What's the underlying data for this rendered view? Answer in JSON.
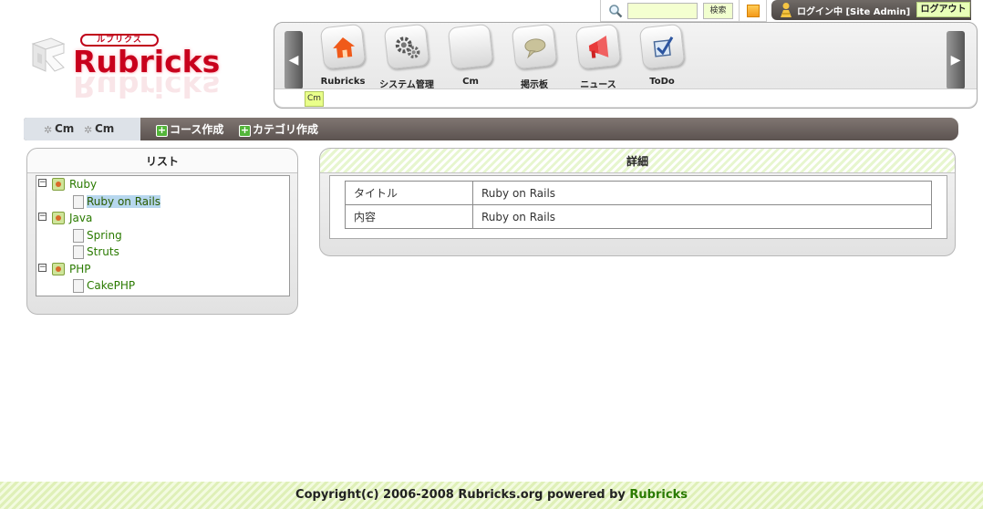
{
  "topbar": {
    "search_placeholder": "",
    "search_button": "検索",
    "user_label": "ログイン中 [Site Admin]",
    "logout_button": "ログアウト"
  },
  "logo": {
    "kana": "ルブリクス",
    "text": "Rubricks"
  },
  "menu": {
    "items": [
      {
        "label": "Rubricks",
        "icon": "house-icon"
      },
      {
        "label": "システム管理",
        "icon": "gears-icon"
      },
      {
        "label": "Cm",
        "icon": "blank-icon"
      },
      {
        "label": "掲示板",
        "icon": "speech-bubble-icon"
      },
      {
        "label": "ニュース",
        "icon": "megaphone-icon"
      },
      {
        "label": "ToDo",
        "icon": "checkbox-icon"
      }
    ],
    "scroll_left": "◀",
    "scroll_right": "▶",
    "sub_tab": "Cm"
  },
  "breadcrumb": {
    "items": [
      "Cm",
      "Cm"
    ]
  },
  "actions": {
    "create_course": "コース作成",
    "create_category": "カテゴリ作成"
  },
  "list_panel": {
    "title": "リスト",
    "categories": [
      {
        "name": "Ruby",
        "courses": [
          "Ruby on Rails"
        ]
      },
      {
        "name": "Java",
        "courses": [
          "Spring",
          "Struts"
        ]
      },
      {
        "name": "PHP",
        "courses": [
          "CakePHP"
        ]
      }
    ],
    "selected_course": "Ruby on Rails"
  },
  "detail_panel": {
    "title": "詳細",
    "rows": [
      {
        "key": "タイトル",
        "value": "Ruby on Rails"
      },
      {
        "key": "内容",
        "value": "Ruby on Rails"
      }
    ]
  },
  "footer": {
    "text": "Copyright(c) 2006-2008 Rubricks.org powered by ",
    "brand": "Rubricks"
  },
  "colors": {
    "accent_green": "#2a7a00",
    "logo_red": "#c8001c",
    "actionbar_brown": "#6a615d",
    "selection_blue": "#b7d7ee"
  }
}
